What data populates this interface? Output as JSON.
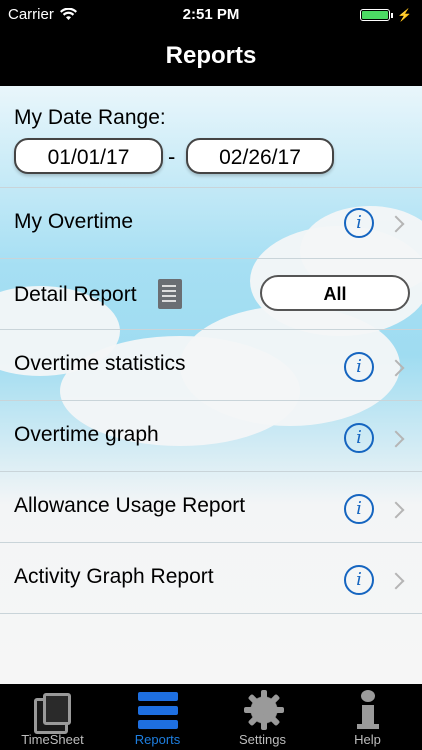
{
  "status": {
    "carrier": "Carrier",
    "time": "2:51 PM"
  },
  "nav": {
    "title": "Reports"
  },
  "date_range": {
    "label": "My Date Range:",
    "start": "01/01/17",
    "separator": "-",
    "end": "02/26/17"
  },
  "rows": {
    "my_overtime": "My Overtime",
    "detail_report": "Detail Report",
    "detail_filter": "All",
    "overtime_statistics": "Overtime statistics",
    "overtime_graph": "Overtime graph",
    "allowance_usage": "Allowance Usage Report",
    "activity_graph": "Activity Graph Report"
  },
  "info_glyph": "i",
  "tabbar": {
    "tabs": [
      {
        "label": "TimeSheet",
        "icon": "timesheet-icon"
      },
      {
        "label": "Reports",
        "icon": "menu-icon",
        "active": true
      },
      {
        "label": "Settings",
        "icon": "gear-icon"
      },
      {
        "label": "Help",
        "icon": "info-icon"
      }
    ]
  },
  "colors": {
    "accent": "#1e7fe0",
    "info_blue": "#1565c0",
    "battery": "#4cd964",
    "sky": "#a6dff3"
  }
}
